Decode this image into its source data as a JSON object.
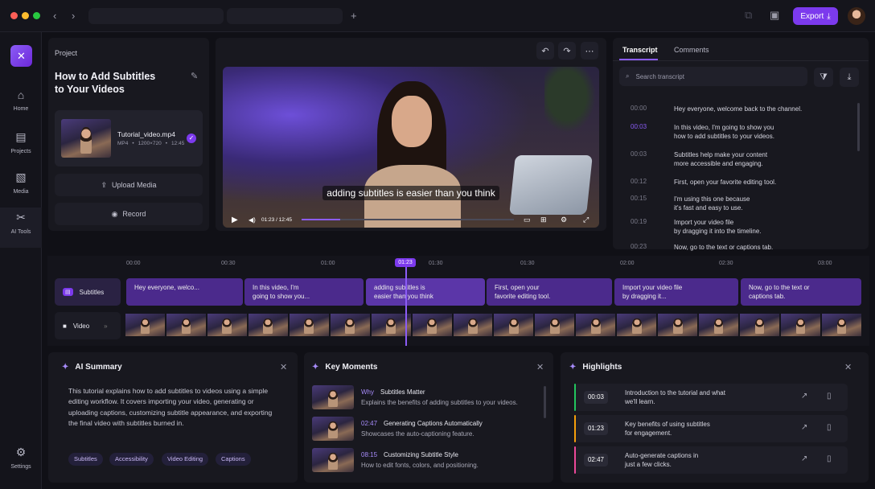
{
  "window": {
    "export_label": "Export"
  },
  "sidebar": {
    "items": [
      {
        "label": "Home"
      },
      {
        "label": "Projects"
      },
      {
        "label": "Media"
      },
      {
        "label": "AI Tools"
      },
      {
        "label": "Settings"
      }
    ]
  },
  "project": {
    "heading": "Project",
    "title_line1": "How to Add Subtitles",
    "title_line2": "to Your Videos",
    "file_name": "Tutorial_video.mp4",
    "file_format": "MP4",
    "file_resolution": "1200×720",
    "file_duration": "12:45",
    "upload_label": "Upload Media",
    "record_label": "Record"
  },
  "player": {
    "caption": "adding subtitles is easier than you think",
    "time": "01:23 / 12:45"
  },
  "transcript_panel": {
    "tabs": [
      "Transcript",
      "Comments"
    ],
    "search_placeholder": "Search transcript",
    "rows": [
      {
        "time": "00:00",
        "line1": "Hey everyone, welcome back to the channel.",
        "line2": ""
      },
      {
        "time": "00:03",
        "line1": "In this video, I'm going to show you",
        "line2": "how to add subtitles to your videos."
      },
      {
        "time": "00:03",
        "line1": "Subtitles help make your content",
        "line2": "more accessible and engaging."
      },
      {
        "time": "00:12",
        "line1": "First, open your favorite editing tool.",
        "line2": ""
      },
      {
        "time": "00:15",
        "line1": "I'm using this one because",
        "line2": "it's fast and easy to use."
      },
      {
        "time": "00:19",
        "line1": "Import your video file",
        "line2": "by dragging it into the timeline."
      },
      {
        "time": "00:23",
        "line1": "Now, go to the text or captions tab.",
        "line2": ""
      }
    ]
  },
  "timeline": {
    "ruler": [
      "00:00",
      "00:30",
      "01:00",
      "01:30",
      "01:30",
      "02:00",
      "02:30",
      "03:00"
    ],
    "playhead": "01:23",
    "subtitles_label": "Subtitles",
    "video_label": "Video",
    "clips": [
      {
        "line1": "Hey everyone, welco...",
        "line2": ""
      },
      {
        "line1": "In this video, I'm",
        "line2": "going to show you..."
      },
      {
        "line1": "adding subtitles is",
        "line2": "easier than you think"
      },
      {
        "line1": "First, open your",
        "line2": "favorite editing tool."
      },
      {
        "line1": "Import your video file",
        "line2": "by dragging it..."
      },
      {
        "line1": "Now, go to the text or",
        "line2": "captions tab."
      }
    ]
  },
  "ai_summary": {
    "title": "AI Summary",
    "body": [
      "This tutorial explains how to add subtitles to videos using a simple",
      "editing workflow. It covers importing your video, generating or",
      "uploading captions, customizing subtitle appearance, and exporting",
      "the final video with subtitles burned in."
    ],
    "chips": [
      "Subtitles",
      "Accessibility",
      "Video Editing",
      "Captions"
    ]
  },
  "key_moments": {
    "title": "Key Moments",
    "items": [
      {
        "time": "Why",
        "title": "Subtitles Matter",
        "desc": "Explains the benefits of adding subtitles to your videos."
      },
      {
        "time": "02:47",
        "title": "Generating Captions Automatically",
        "desc": "Showcases the auto-captioning feature."
      },
      {
        "time": "08:15",
        "title": "Customizing Subtitle Style",
        "desc": "How to edit fonts, colors, and positioning."
      }
    ]
  },
  "highlights": {
    "title": "Highlights",
    "items": [
      {
        "time": "00:03",
        "line1": "Introduction to the tutorial and what",
        "line2": "we'll learn.",
        "color": "#22c55e"
      },
      {
        "time": "01:23",
        "line1": "Key benefits of using subtitles",
        "line2": "for engagement.",
        "color": "#f59e0b"
      },
      {
        "time": "02:47",
        "line1": "Auto-generate captions in",
        "line2": "just a few clicks.",
        "color": "#ec4899"
      }
    ]
  },
  "colors": {
    "accent": "#7c3aed",
    "background": "#101016",
    "panel": "#18181f"
  }
}
